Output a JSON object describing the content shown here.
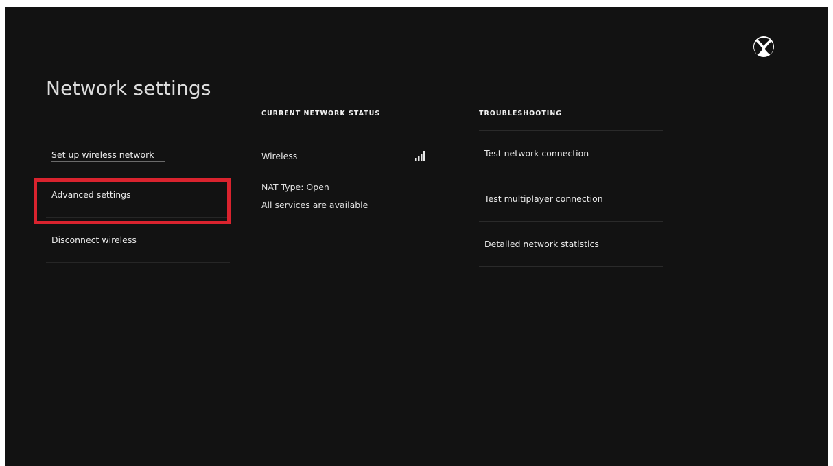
{
  "page": {
    "title": "Network settings",
    "logo_icon": "xbox-logo-icon"
  },
  "left_menu": {
    "items": [
      {
        "label": "Set up wireless network"
      },
      {
        "label": "Advanced settings",
        "highlighted": true
      },
      {
        "label": "Disconnect wireless"
      }
    ],
    "highlight_color": "#d9232e"
  },
  "network_status": {
    "heading": "CURRENT NETWORK STATUS",
    "connection_type": "Wireless",
    "signal_icon": "signal-strength-icon",
    "nat_type": "NAT Type: Open",
    "services": "All services are available"
  },
  "troubleshooting": {
    "heading": "TROUBLESHOOTING",
    "items": [
      {
        "label": "Test network connection"
      },
      {
        "label": "Test multiplayer connection"
      },
      {
        "label": "Detailed network statistics"
      }
    ]
  },
  "colors": {
    "background": "#121212",
    "text": "#e8e8e8"
  }
}
